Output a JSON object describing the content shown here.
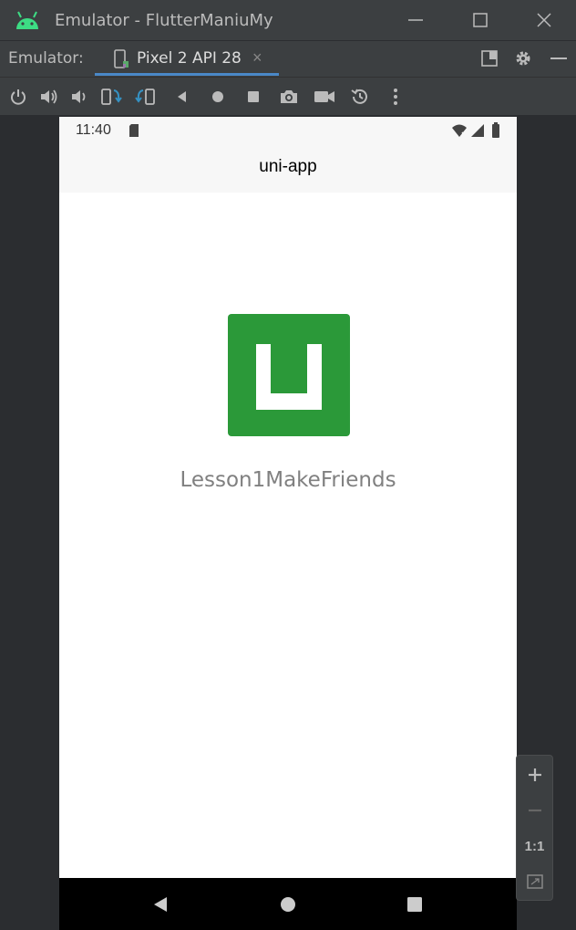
{
  "window": {
    "title": "Emulator - FlutterManiuMy"
  },
  "tabbar": {
    "label": "Emulator:",
    "tab_label": "Pixel 2 API 28",
    "close": "×"
  },
  "device": {
    "status_time": "11:40",
    "app_title": "uni-app",
    "app_name": "Lesson1MakeFriends",
    "logo_color": "#2b9939"
  },
  "zoom": {
    "one_to_one": "1:1"
  },
  "colors": {
    "accent": "#4a88c7",
    "android_green": "#3ddc84"
  }
}
